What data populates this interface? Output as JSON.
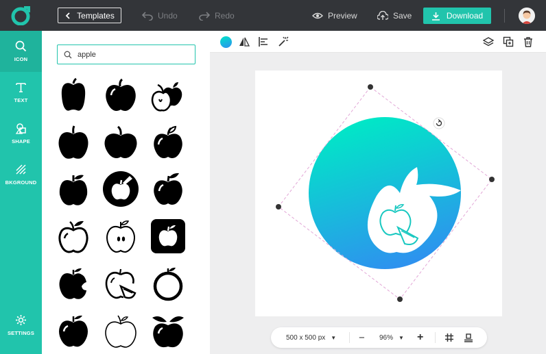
{
  "app": {
    "accent": "#21c4ac",
    "topbar_bg": "#333539"
  },
  "topbar": {
    "templates_label": "Templates",
    "undo_label": "Undo",
    "redo_label": "Redo",
    "preview_label": "Preview",
    "save_label": "Save",
    "download_label": "Download"
  },
  "sidebar": {
    "items": [
      {
        "label": "ICON",
        "icon": "search-icon"
      },
      {
        "label": "TEXT",
        "icon": "text-icon"
      },
      {
        "label": "SHAPE",
        "icon": "shapes-icon"
      },
      {
        "label": "BKGROUND",
        "icon": "background-pattern-icon"
      },
      {
        "label": "SETTINGS",
        "icon": "gear-icon"
      }
    ]
  },
  "search": {
    "value": "apple",
    "placeholder": ""
  },
  "icons": [
    "apple-solid-icon",
    "apple-round-solid-icon",
    "apple-pair-icon",
    "apple-classic-icon",
    "apple-wide-icon",
    "apple-shine-icon",
    "apple-leaf-icon",
    "apple-circle-badge-icon",
    "apple-glossy-icon",
    "apple-outline-icon",
    "apple-half-icon",
    "apple-rounded-square-icon",
    "apple-bitten-icon",
    "apple-slice-outline-icon",
    "apple-ring-icon",
    "apple-shine-small-icon",
    "apple-thin-outline-icon",
    "apple-two-leaves-icon"
  ],
  "toolbar": {
    "fill_color_start": "#00e5c8",
    "fill_color_end": "#2f8ff0"
  },
  "bottombar": {
    "canvas_size": "500 x 500 px",
    "zoom": "96%",
    "minus": "−",
    "plus": "+"
  }
}
